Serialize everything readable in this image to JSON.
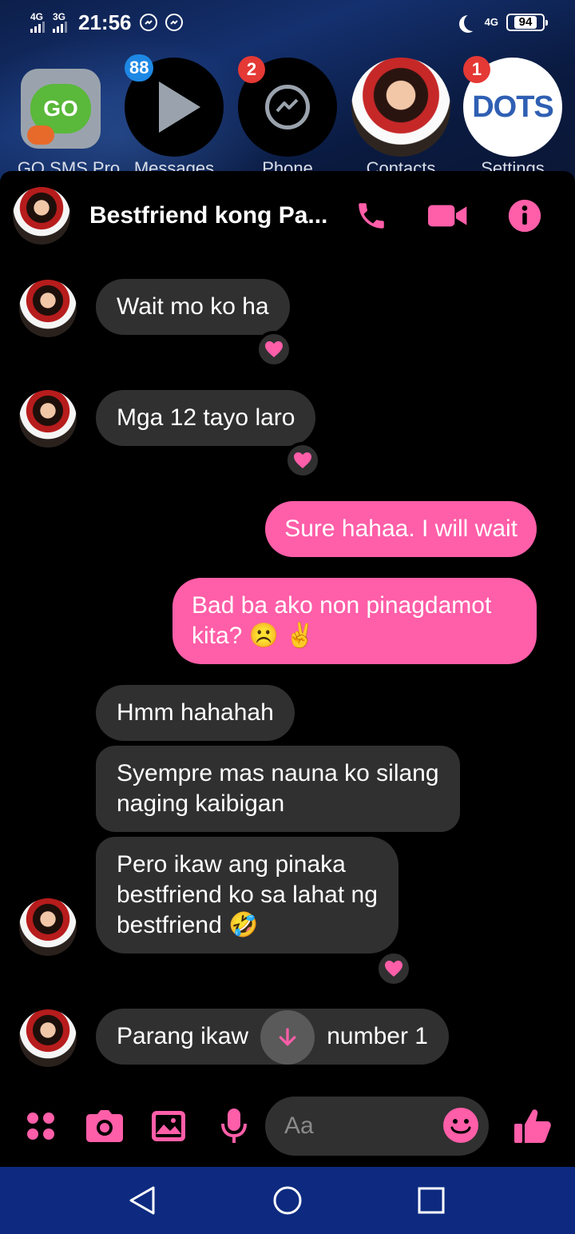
{
  "statusbar": {
    "sim1": "4G",
    "sim2": "3G",
    "time": "21:56",
    "network": "4G",
    "battery": "94"
  },
  "home": {
    "apps": [
      {
        "label": "GO SMS Pro",
        "icon": "go-sms-icon",
        "badge": ""
      },
      {
        "label": "Messages",
        "icon": "play-icon",
        "badge": "88"
      },
      {
        "label": "Phone",
        "icon": "messenger-icon",
        "badge": "2"
      },
      {
        "label": "Contacts",
        "icon": "contact-photo",
        "badge": ""
      },
      {
        "label": "Settings",
        "icon": "dots-icon",
        "badge": "1"
      }
    ],
    "gosms_logo": "GO",
    "dots_logo": "DOTS"
  },
  "chat": {
    "title": "Bestfriend kong Pa...",
    "messages": [
      {
        "from": "them",
        "text": "Wait mo ko ha",
        "reaction": "heart"
      },
      {
        "from": "them",
        "text": "Mga 12 tayo laro",
        "reaction": "heart"
      },
      {
        "from": "me",
        "text": "Sure hahaa. I will wait"
      },
      {
        "from": "me",
        "line1": "Bad ba ako non pinagdamot",
        "line2": "kita? ☹️ ✌️"
      },
      {
        "from": "them",
        "text": "Hmm hahahah"
      },
      {
        "from": "them",
        "line1": "Syempre mas nauna ko silang",
        "line2": "naging kaibigan"
      },
      {
        "from": "them",
        "line1": "Pero ikaw ang pinaka",
        "line2": "bestfriend ko sa lahat ng",
        "line3": "bestfriend 🤣",
        "reaction": "heart"
      },
      {
        "from": "them",
        "left": "Parang ikaw",
        "right": "number 1"
      }
    ]
  },
  "composer": {
    "placeholder": "Aa"
  },
  "colors": {
    "accent": "#ff5ea8",
    "incoming_bubble": "#303030",
    "navbar": "#0d2a80"
  }
}
